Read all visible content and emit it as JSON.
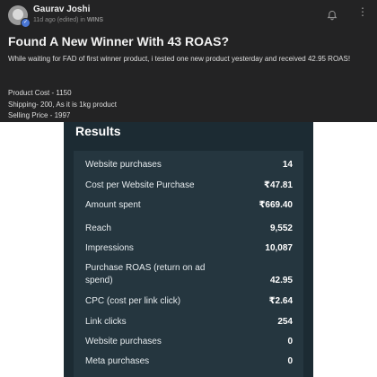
{
  "post": {
    "author": "Gaurav Joshi",
    "meta_prefix": "11d ago (edited) in ",
    "group": "WINS",
    "title": "Found A New Winner With 43 ROAS?",
    "body": "While waiting for FAD of first winner product, i tested one new product yesterday and received 42.95 ROAS!",
    "stats": [
      "Product Cost - 1150",
      "Shipping- 200, As it is 1kg product",
      "Selling Price - 1997"
    ],
    "icons": {
      "avatar": "user-avatar",
      "bell": "bell-icon",
      "more": "more-options-icon"
    }
  },
  "results": {
    "heading": "Results",
    "rows": [
      {
        "label": "Website purchases",
        "value": "14"
      },
      {
        "label": "Cost per Website Purchase",
        "value": "₹47.81"
      },
      {
        "label": "Amount spent",
        "value": "₹669.40"
      },
      {
        "label": "Reach",
        "value": "9,552"
      },
      {
        "label": "Impressions",
        "value": "10,087"
      },
      {
        "label": "Purchase ROAS (return on ad spend)",
        "value": "42.95"
      },
      {
        "label": "CPC (cost per link click)",
        "value": "₹2.64"
      },
      {
        "label": "Link clicks",
        "value": "254"
      },
      {
        "label": "Website purchases",
        "value": "0"
      },
      {
        "label": "Meta purchases",
        "value": "0"
      }
    ]
  },
  "colors": {
    "post_background": "#232324",
    "results_background": "#1c2b33",
    "metrics_background": "#25363f"
  }
}
